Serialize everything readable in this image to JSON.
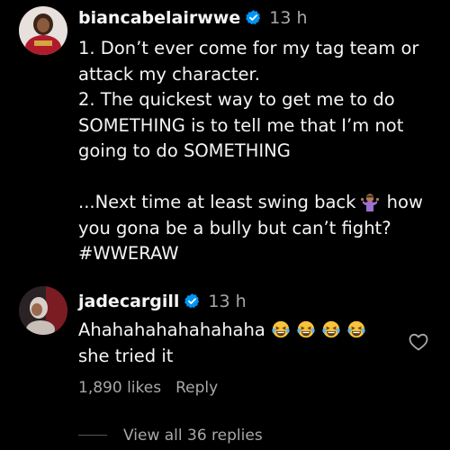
{
  "comments": [
    {
      "username": "biancabelairwwe",
      "verified": true,
      "time": "13 h",
      "lines": [
        "1. Don’t ever come for my tag team or",
        "attack my character.",
        "2. The quickest way to get me to do",
        "SOMETHING is to tell me that I’m not",
        "going to do SOMETHING",
        "",
        "...Next time at least swing back",
        "how",
        "you gona be a bully but can’t fight?",
        "#WWERAW"
      ],
      "emoji_icon": "person-shrugging-emoji"
    },
    {
      "username": "jadecargill",
      "verified": true,
      "time": "13 h",
      "line1": "Ahahahahahahahaha",
      "line2": "she tried it",
      "emoji_icons": [
        "laughing-crying-emoji",
        "laughing-crying-emoji",
        "laughing-crying-emoji",
        "laughing-crying-emoji"
      ],
      "likes": "1,890 likes",
      "reply_label": "Reply",
      "view_replies": "View all 36 replies"
    }
  ],
  "colors": {
    "background": "#000000",
    "text": "#f5f5f5",
    "secondary": "#a8a8a8",
    "verified_blue": "#0095f6"
  }
}
